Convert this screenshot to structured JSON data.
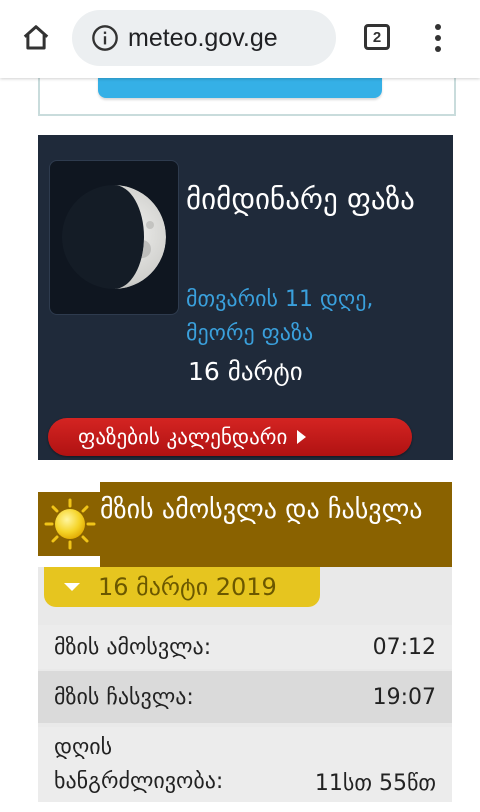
{
  "browser": {
    "url": "meteo.gov.ge",
    "tab_count": "2"
  },
  "moon": {
    "title": "მიმდინარე ფაზა",
    "subtitle": "მთვარის 11 დღე, მეორე ფაზა",
    "date": "16 მარტი",
    "calendar_button": "ფაზების კალენდარი"
  },
  "sun": {
    "title": "მზის ამოსვლა და ჩასვლა",
    "date": "16 მარტი 2019",
    "rows": [
      {
        "label": "მზის ამოსვლა:",
        "value": "07:12"
      },
      {
        "label": "მზის ჩასვლა:",
        "value": "19:07"
      },
      {
        "label": "დღის ხანგრძლივობა:",
        "value": "11სთ 55წთ"
      }
    ]
  },
  "colors": {
    "moon_panel_bg": "#1f2a3a",
    "moon_subtitle": "#3aa0dc",
    "calendar_button": "#c81c1a",
    "sun_header": "#8a6200",
    "date_bar": "#e6c51f"
  }
}
